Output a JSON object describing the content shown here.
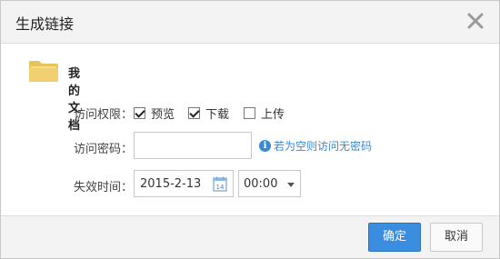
{
  "dialog": {
    "title": "生成链接",
    "close_icon": "close-icon"
  },
  "folder": {
    "icon": "folder-icon",
    "name": "我的文档"
  },
  "permission": {
    "label": "访问权限：",
    "options": [
      {
        "label": "预览",
        "checked": true
      },
      {
        "label": "下载",
        "checked": true
      },
      {
        "label": "上传",
        "checked": false
      }
    ]
  },
  "password": {
    "label": "访问密码：",
    "value": "",
    "hint": "若为空则访问无密码",
    "hint_icon": "info-icon"
  },
  "expiry": {
    "label": "失效时间：",
    "date": "2015-2-13",
    "calendar_day": "14",
    "calendar_icon": "calendar-icon",
    "time": "00:00"
  },
  "buttons": {
    "ok": "确定",
    "cancel": "取消"
  },
  "colors": {
    "accent": "#3b8de0",
    "hint": "#3a8ad3",
    "header_bg": "#f3f3f3"
  }
}
